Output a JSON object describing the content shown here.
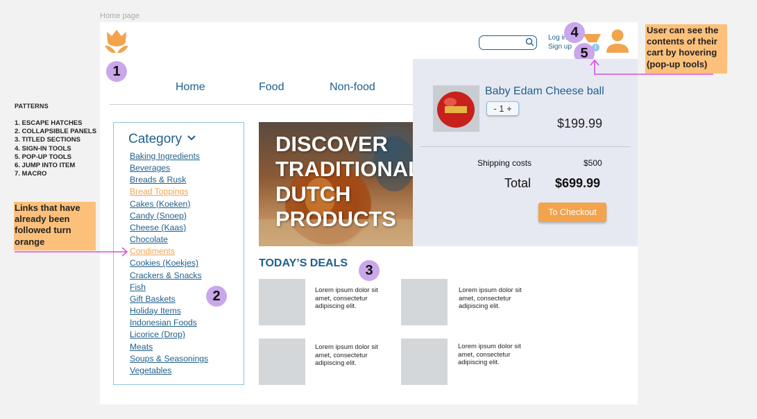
{
  "frame_label": "Home page",
  "patterns": {
    "title": "PATTERNS",
    "items": [
      "1. ESCAPE HATCHES",
      "2. COLLAPSIBLE PANELS",
      "3. TITLED SECTIONS",
      "4. SIGN-IN TOOLS",
      "5. POP-UP TOOLS",
      "6. JUMP INTO ITEM",
      "7. MACRO"
    ]
  },
  "notes": {
    "links": "Links that have already been followed turn orange",
    "cart": "User can see the contents of their cart by hovering (pop-up tools)"
  },
  "badges": [
    "1",
    "2",
    "3",
    "4",
    "5"
  ],
  "header": {
    "search_placeholder": "",
    "login": "Log in",
    "signup": "Sign up",
    "cart_count": "1"
  },
  "nav": [
    "Home",
    "Food",
    "Non-food"
  ],
  "category": {
    "title": "Category",
    "items": [
      {
        "label": "Baking Ingredients",
        "visited": false
      },
      {
        "label": "Beverages",
        "visited": false
      },
      {
        "label": "Breads & Rusk",
        "visited": false
      },
      {
        "label": "Bread Toppings",
        "visited": true
      },
      {
        "label": "Cakes (Koeken)",
        "visited": false
      },
      {
        "label": "Candy (Snoep)",
        "visited": false
      },
      {
        "label": "Cheese (Kaas)",
        "visited": false
      },
      {
        "label": "Chocolate",
        "visited": false
      },
      {
        "label": "Condiments",
        "visited": true
      },
      {
        "label": "Cookies (Koekjes)",
        "visited": false
      },
      {
        "label": "Crackers & Snacks",
        "visited": false
      },
      {
        "label": "Fish",
        "visited": false
      },
      {
        "label": "Gift Baskets",
        "visited": false
      },
      {
        "label": "Holiday Items",
        "visited": false
      },
      {
        "label": "Indonesian Foods",
        "visited": false
      },
      {
        "label": "Licorice (Drop)",
        "visited": false
      },
      {
        "label": "Meats",
        "visited": false
      },
      {
        "label": "Soups & Seasonings",
        "visited": false
      },
      {
        "label": "Vegetables",
        "visited": false
      }
    ]
  },
  "hero": {
    "text": "DISCOVER\nTRADITIONAL\nDUTCH\nPRODUCTS"
  },
  "deals": {
    "title": "TODAY’S DEALS",
    "items": [
      "Lorem ipsum dolor sit amet, consectetur adipiscing elit.",
      "Lorem ipsum dolor sit amet, consectetur adipiscing elit.",
      "Lorem ipsum dolor sit amet, consectetur adipiscing elit.",
      "Lorem ipsum dolor sit amet, consectetur adipiscing elit."
    ]
  },
  "cart_popup": {
    "product_name": "Baby Edam Cheese ball",
    "quantity": "- 1 +",
    "price": "$199.99",
    "shipping_label": "Shipping costs",
    "shipping_value": "$500",
    "total_label": "Total",
    "total_value": "$699.99",
    "checkout_label": "To Checkout"
  },
  "colors": {
    "brand_blue": "#1f5f8b",
    "accent_orange": "#f2a34c",
    "note_bg": "#fcc07a",
    "badge_purple": "#c9a7ea",
    "arrow_magenta": "#d94fe0",
    "popup_bg": "#e6e9f2"
  }
}
